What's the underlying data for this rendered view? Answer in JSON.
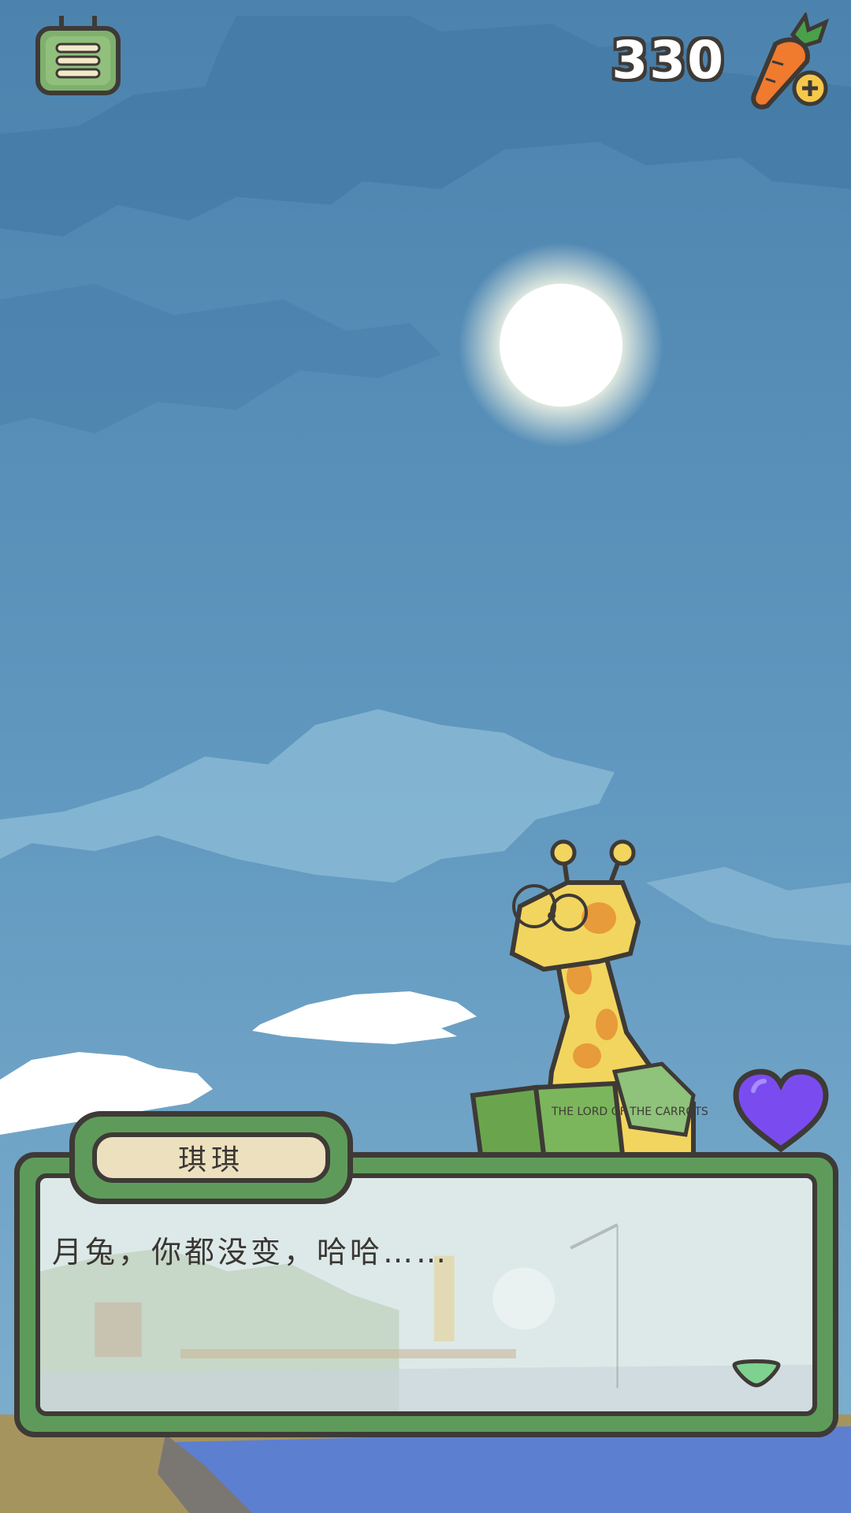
{
  "hud": {
    "carrot_count": "330",
    "menu_icon": "menu-icon",
    "carrot_icon": "carrot-add-icon",
    "heart_icon": "heart-icon",
    "heart_color": "#7a4cf0"
  },
  "dialog": {
    "speaker": "琪琪",
    "text": "月兔，你都没变，哈哈……"
  },
  "scene": {
    "book_title": "THE LORD OF THE CARROTS",
    "sky_color": "#4f86b2",
    "moon_color": "#ffffff"
  }
}
